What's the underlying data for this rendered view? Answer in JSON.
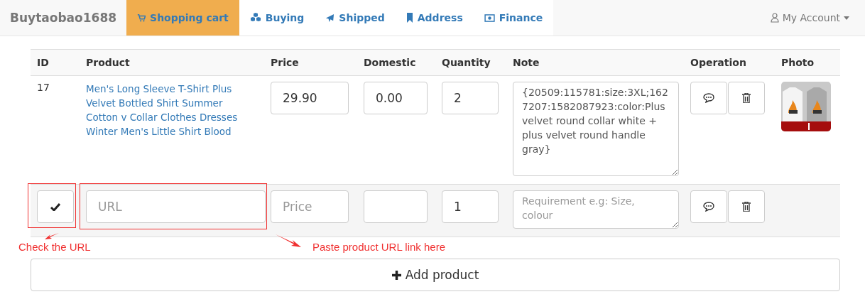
{
  "navbar": {
    "brand": "Buytaobao1688",
    "items": [
      {
        "label": "Shopping cart",
        "selected": true
      },
      {
        "label": "Buying",
        "selected": false
      },
      {
        "label": "Shipped",
        "selected": false
      },
      {
        "label": "Address",
        "selected": false
      },
      {
        "label": "Finance",
        "selected": false
      }
    ],
    "account": "My Account"
  },
  "table": {
    "columns": [
      "ID",
      "Product",
      "Price",
      "Domestic",
      "Quantity",
      "Note",
      "Operation",
      "Photo"
    ],
    "rows": [
      {
        "kind": "item",
        "id": "17",
        "product": "Men's Long Sleeve T-Shirt Plus Velvet Bottled Shirt Summer Cotton v Collar Clothes Dresses Winter Men's Little Shirt Blood",
        "price": "29.90",
        "domestic": "0.00",
        "quantity": "2",
        "note": "{20509:115781:size:3XL;1627207:1582087923:color:Plus velvet round collar white + plus velvet round handle gray}"
      },
      {
        "kind": "new",
        "url_placeholder": "URL",
        "price_placeholder": "Price",
        "quantity": "1",
        "note_placeholder": "Requirement e.g: Size, colour"
      }
    ]
  },
  "annotations": [
    {
      "text": "Check the URL"
    },
    {
      "text": "Paste product URL link here"
    }
  ],
  "add_button": "Add product"
}
